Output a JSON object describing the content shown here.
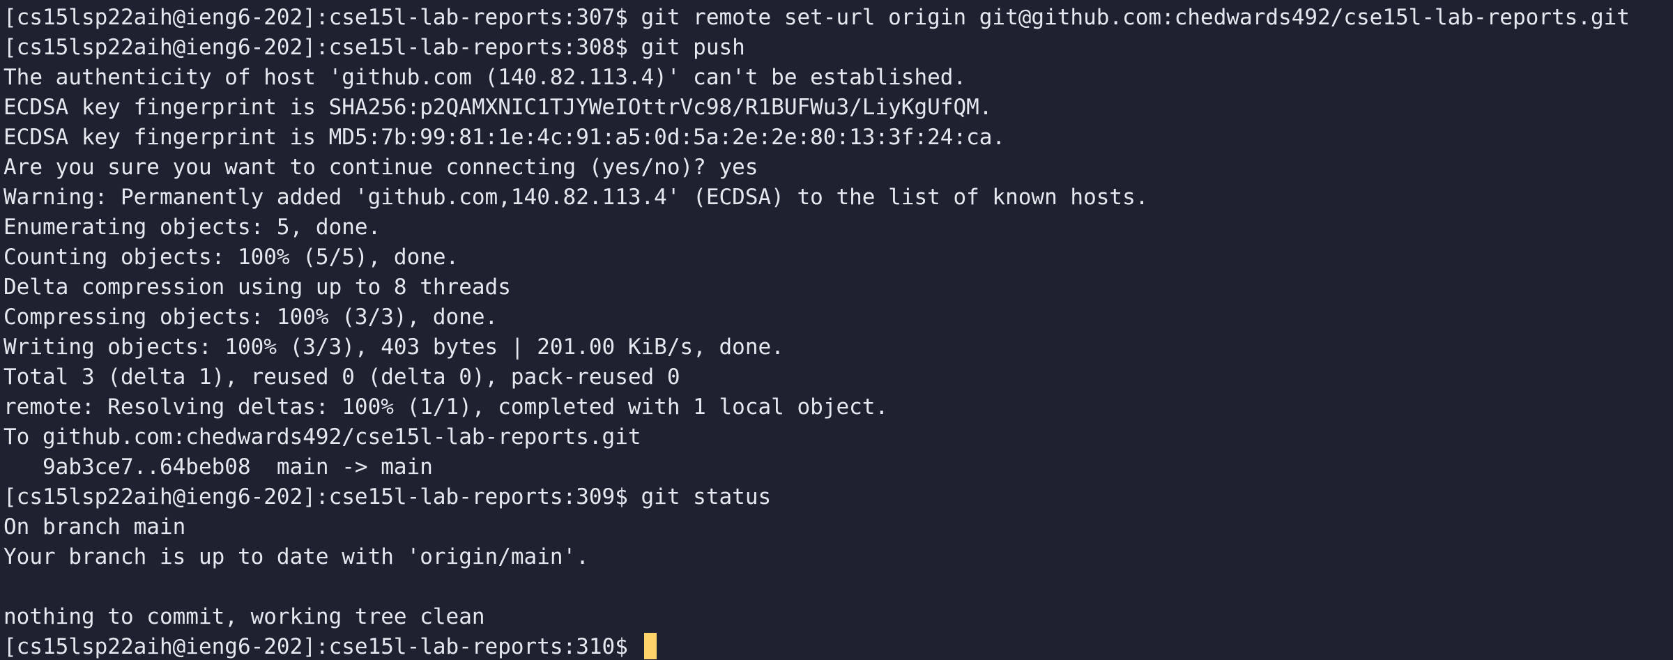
{
  "terminal": {
    "lines": [
      "[cs15lsp22aih@ieng6-202]:cse15l-lab-reports:307$ git remote set-url origin git@github.com:chedwards492/cse15l-lab-reports.git",
      "[cs15lsp22aih@ieng6-202]:cse15l-lab-reports:308$ git push",
      "The authenticity of host 'github.com (140.82.113.4)' can't be established.",
      "ECDSA key fingerprint is SHA256:p2QAMXNIC1TJYWeIOttrVc98/R1BUFWu3/LiyKgUfQM.",
      "ECDSA key fingerprint is MD5:7b:99:81:1e:4c:91:a5:0d:5a:2e:2e:80:13:3f:24:ca.",
      "Are you sure you want to continue connecting (yes/no)? yes",
      "Warning: Permanently added 'github.com,140.82.113.4' (ECDSA) to the list of known hosts.",
      "Enumerating objects: 5, done.",
      "Counting objects: 100% (5/5), done.",
      "Delta compression using up to 8 threads",
      "Compressing objects: 100% (3/3), done.",
      "Writing objects: 100% (3/3), 403 bytes | 201.00 KiB/s, done.",
      "Total 3 (delta 1), reused 0 (delta 0), pack-reused 0",
      "remote: Resolving deltas: 100% (1/1), completed with 1 local object.",
      "To github.com:chedwards492/cse15l-lab-reports.git",
      "   9ab3ce7..64beb08  main -> main",
      "[cs15lsp22aih@ieng6-202]:cse15l-lab-reports:309$ git status",
      "On branch main",
      "Your branch is up to date with 'origin/main'.",
      "",
      "nothing to commit, working tree clean"
    ],
    "prompt": "[cs15lsp22aih@ieng6-202]:cse15l-lab-reports:310$ ",
    "background_color": "#1e2230",
    "text_color": "#e6e8ef",
    "cursor_color": "#ffd36a"
  }
}
